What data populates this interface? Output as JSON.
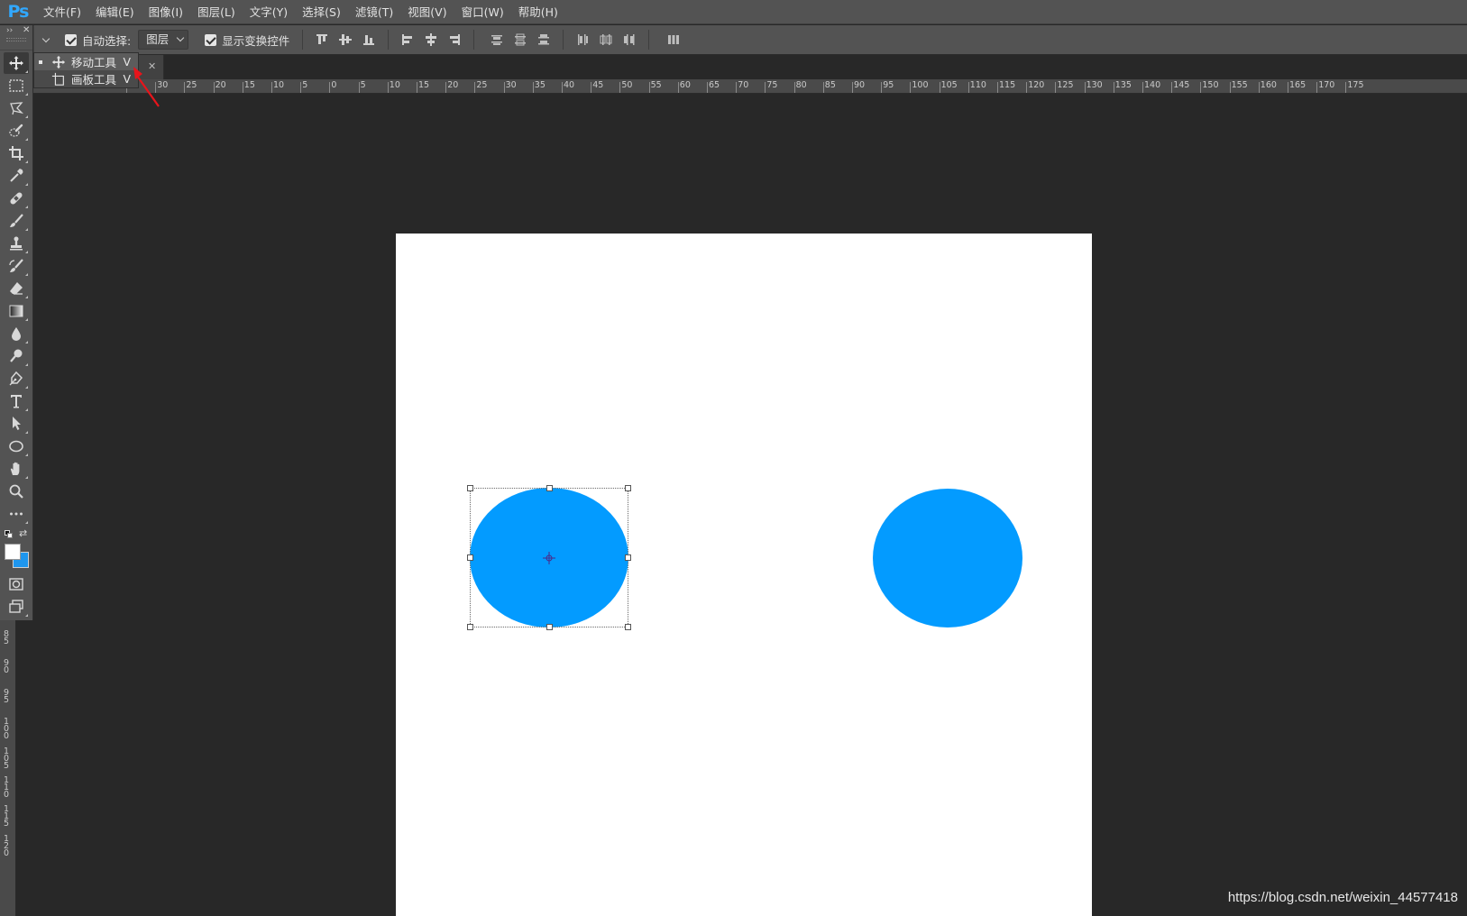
{
  "app": {
    "logo": "Ps"
  },
  "menu": [
    "文件(F)",
    "编辑(E)",
    "图像(I)",
    "图层(L)",
    "文字(Y)",
    "选择(S)",
    "滤镜(T)",
    "视图(V)",
    "窗口(W)",
    "帮助(H)"
  ],
  "options": {
    "auto_select_label": "自动选择:",
    "auto_select_checked": true,
    "auto_select_target": "图层",
    "show_transform_label": "显示变换控件",
    "show_transform_checked": true
  },
  "flyout": {
    "items": [
      {
        "label": "移动工具",
        "shortcut": "V",
        "selected": true
      },
      {
        "label": "画板工具",
        "shortcut": "V",
        "selected": false
      }
    ]
  },
  "ruler": {
    "h_labels": [
      "35",
      "30",
      "25",
      "20",
      "15",
      "10",
      "5",
      "0",
      "5",
      "10",
      "15",
      "20",
      "25",
      "30",
      "35",
      "40",
      "45",
      "50",
      "55",
      "60",
      "65",
      "70",
      "75",
      "80",
      "85",
      "90",
      "95",
      "100",
      "105",
      "110",
      "115",
      "120",
      "125",
      "130",
      "135",
      "140",
      "145",
      "150",
      "155",
      "160",
      "165",
      "170",
      "175"
    ],
    "v_labels": [
      "85",
      "90",
      "95",
      "100",
      "105",
      "110",
      "115",
      "120"
    ]
  },
  "swatches": {
    "foreground": "#ffffff",
    "background": "#1e96ee"
  },
  "canvas": {
    "shape_color": "#039bff"
  },
  "watermark": "https://blog.csdn.net/weixin_44577418",
  "icons": [
    "move-icon",
    "marquee-icon",
    "lasso-icon",
    "quick-select-icon",
    "crop-icon",
    "eyedropper-icon",
    "healing-icon",
    "brush-icon",
    "stamp-icon",
    "history-brush-icon",
    "eraser-icon",
    "gradient-icon",
    "blur-icon",
    "dodge-icon",
    "pen-icon",
    "type-icon",
    "path-select-icon",
    "ellipse-icon",
    "hand-icon",
    "zoom-icon",
    "more-icon"
  ]
}
